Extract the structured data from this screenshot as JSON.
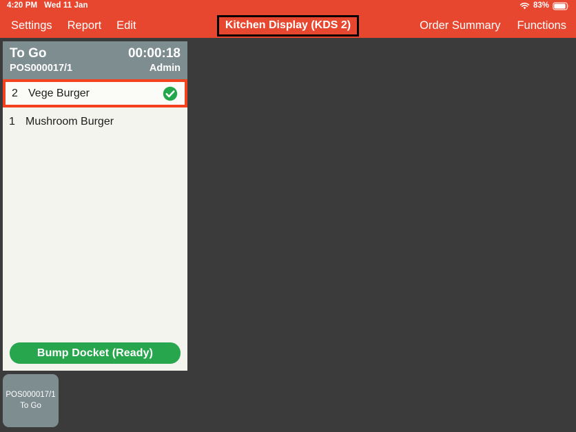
{
  "colors": {
    "top_bar": "#e8472f",
    "background": "#3b3b3b",
    "docket_header": "#7e8d90",
    "docket_body": "#f4f4ef",
    "highlight_border": "#f4411e",
    "bump_button": "#28a64d",
    "check_green": "#22a84a"
  },
  "status_bar": {
    "time": "4:20 PM",
    "date": "Wed 11 Jan",
    "battery_percent": "83%",
    "wifi_icon": "wifi-icon",
    "battery_icon": "battery-icon"
  },
  "nav": {
    "left_items": [
      {
        "label": "Settings",
        "name": "nav-settings"
      },
      {
        "label": "Report",
        "name": "nav-report"
      },
      {
        "label": "Edit",
        "name": "nav-edit"
      }
    ],
    "title": "Kitchen Display (KDS 2)",
    "right_items": [
      {
        "label": "Order Summary",
        "name": "nav-order-summary"
      },
      {
        "label": "Functions",
        "name": "nav-functions"
      }
    ]
  },
  "docket": {
    "order_type": "To Go",
    "reference": "POS000017/1",
    "timer": "00:00:18",
    "user": "Admin",
    "items": [
      {
        "qty": "2",
        "name": "Vege Burger",
        "ready": true,
        "selected": true
      },
      {
        "qty": "1",
        "name": "Mushroom Burger",
        "ready": false,
        "selected": false
      }
    ],
    "bump_label": "Bump Docket (Ready)"
  },
  "dock": {
    "tiles": [
      {
        "reference": "POS000017/1",
        "order_type": "To Go"
      }
    ]
  }
}
